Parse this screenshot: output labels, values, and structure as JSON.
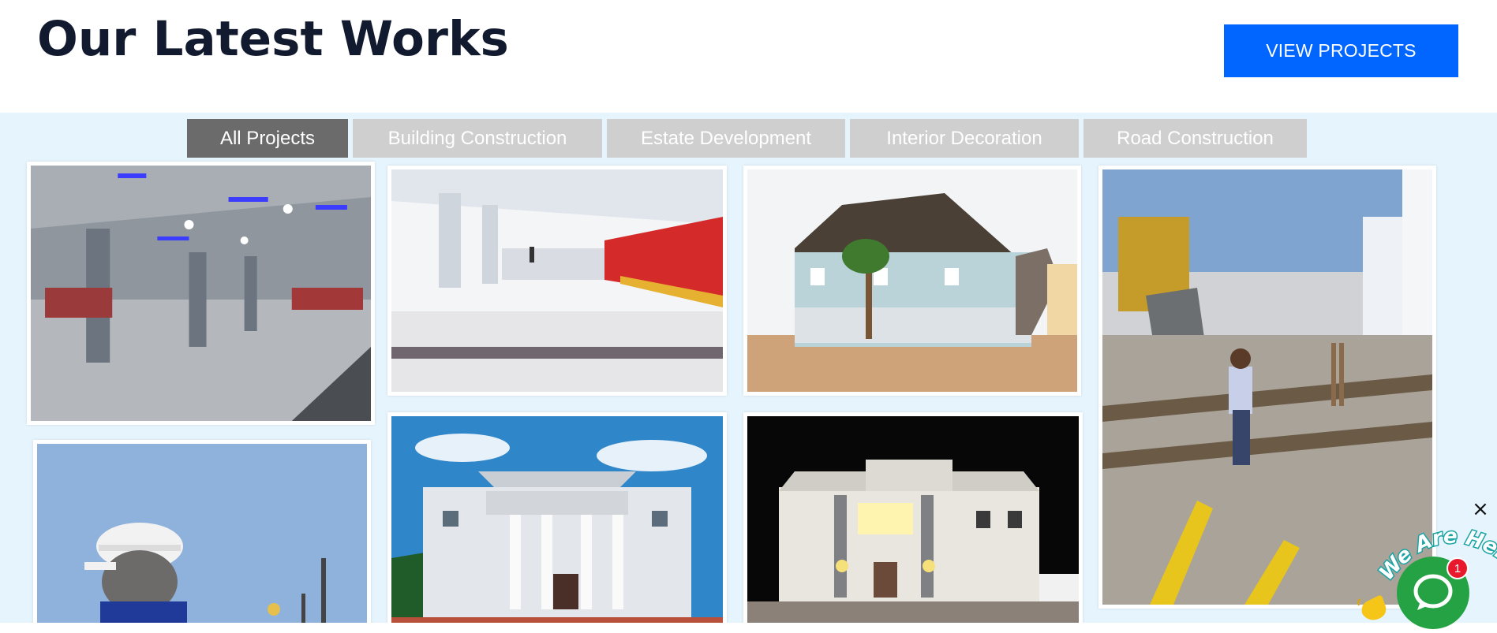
{
  "header": {
    "title": "Our Latest Works",
    "cta_label": "VIEW PROJECTS"
  },
  "filters": {
    "tabs": [
      {
        "label": "All Projects",
        "active": true
      },
      {
        "label": "Building Construction",
        "active": false
      },
      {
        "label": "Estate Development",
        "active": false
      },
      {
        "label": "Interior Decoration",
        "active": false
      },
      {
        "label": "Road Construction",
        "active": false
      }
    ]
  },
  "gallery": {
    "items": [
      {
        "subject": "event hall interior with blue ceiling lights"
      },
      {
        "subject": "hall interior with red chairs"
      },
      {
        "subject": "two-storey house exterior"
      },
      {
        "subject": "construction site worker on rebar"
      },
      {
        "subject": "worker in hard hat"
      },
      {
        "subject": "white mansion daytime"
      },
      {
        "subject": "mansion at night"
      }
    ]
  },
  "chat": {
    "close_icon": "×",
    "tagline": "We Are Here!",
    "badge_count": "1"
  },
  "colors": {
    "title": "#111a2e",
    "cta_bg": "#0066ff",
    "tab_active": "#6b6b6b",
    "tab_inactive": "#cfcfcf",
    "gallery_bg": "#e6f4fd",
    "chat_green": "#25a244",
    "badge_red": "#e8192c"
  }
}
